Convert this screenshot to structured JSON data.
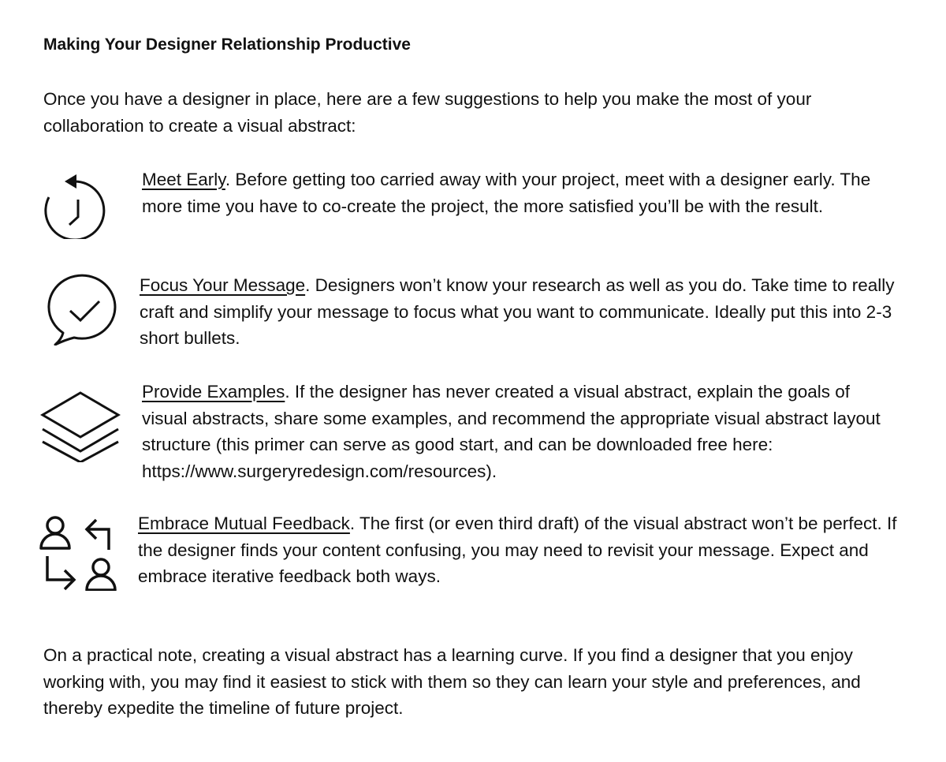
{
  "document": {
    "title": "Making Your Designer Relationship Productive",
    "intro": "Once you have a designer in place, here are a few suggestions to help you make the most of your collaboration to create a visual abstract:",
    "items": [
      {
        "icon": "clock-rewind-icon",
        "heading": "Meet Early",
        "body": ". Before getting too carried away with your project, meet with a designer early. The more time you have to co-create the project, the more satisfied you’ll be with the result."
      },
      {
        "icon": "chat-check-icon",
        "heading": "Focus Your Message",
        "body": ". Designers won’t know your research as well as you do. Take time to really craft and simplify your message to focus what you want to communicate. Ideally put this into 2-3 short bullets."
      },
      {
        "icon": "layers-icon",
        "heading": "Provide Examples",
        "body": ". If the designer has never created a visual abstract, explain the goals of visual abstracts, share some examples, and recommend the appropriate visual abstract layout structure (this primer can serve as good start, and can be downloaded free here: https://www.surgeryredesign.com/resources)."
      },
      {
        "icon": "user-exchange-icon",
        "heading": "Embrace Mutual Feedback",
        "body": ". The first (or even third draft) of the visual abstract won’t be perfect.  If the designer finds your content confusing, you may need to revisit your message. Expect and embrace iterative feedback both ways."
      }
    ],
    "closing": "On a practical note, creating a visual abstract has a learning curve. If you find a designer that you enjoy working with, you may find it easiest to stick with them so they can learn your style and preferences, and thereby expedite the timeline of future project."
  }
}
